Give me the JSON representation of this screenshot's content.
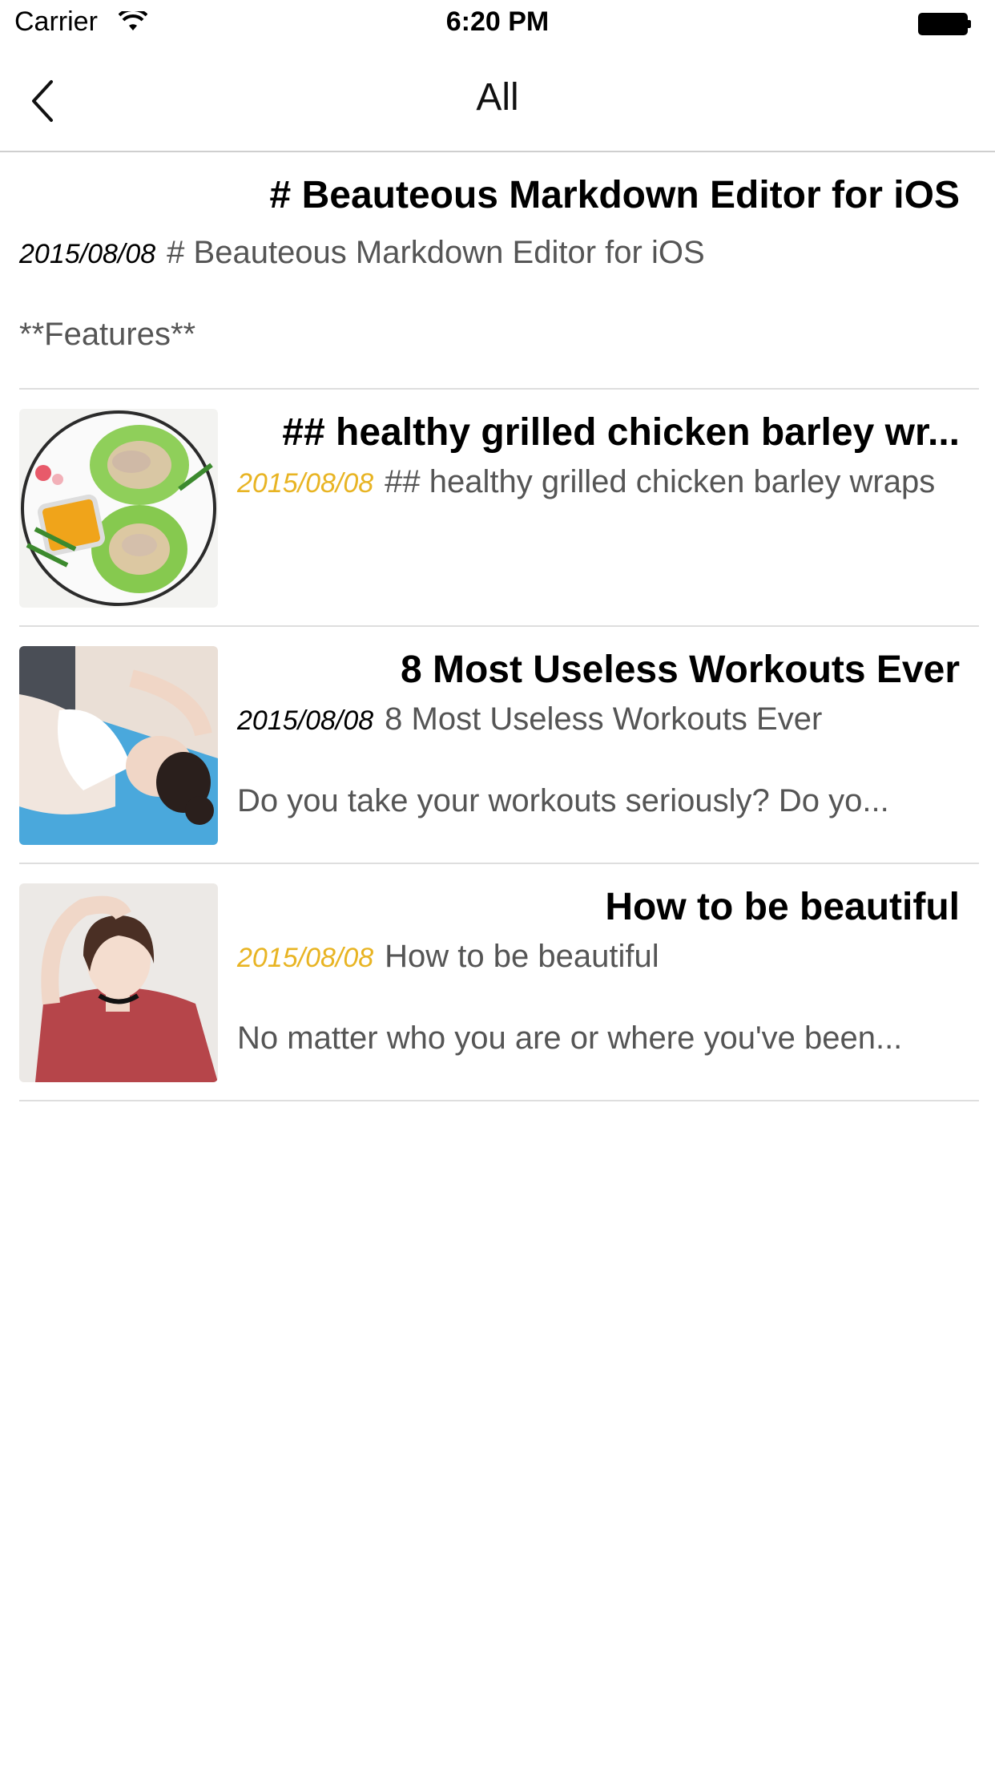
{
  "status_bar": {
    "carrier": "Carrier",
    "time": "6:20 PM"
  },
  "nav": {
    "title": "All",
    "back_icon": "chevron-left-icon"
  },
  "notes": [
    {
      "title": "# Beauteous Markdown Editor for iOS",
      "date": "2015/08/08",
      "date_color": "#000000",
      "summary": "# Beauteous Markdown Editor for iOS",
      "excerpt": "**Features**",
      "has_thumbnail": false
    },
    {
      "title": "## healthy grilled chicken barley wr...",
      "date": "2015/08/08",
      "date_color": "#e8b423",
      "summary": "## healthy grilled chicken barley wraps",
      "excerpt": "",
      "has_thumbnail": true,
      "thumbnail": "salad-plate-image"
    },
    {
      "title": "8 Most Useless Workouts Ever",
      "date": "2015/08/08",
      "date_color": "#000000",
      "summary": "8 Most Useless Workouts Ever",
      "excerpt": "Do you take your workouts seriously? Do yo...",
      "has_thumbnail": true,
      "thumbnail": "workout-woman-image"
    },
    {
      "title": "How to be beautiful",
      "date": "2015/08/08",
      "date_color": "#e8b423",
      "summary": "How to be beautiful",
      "excerpt": "No matter who you are or where you've been...",
      "has_thumbnail": true,
      "thumbnail": "portrait-woman-image"
    }
  ]
}
